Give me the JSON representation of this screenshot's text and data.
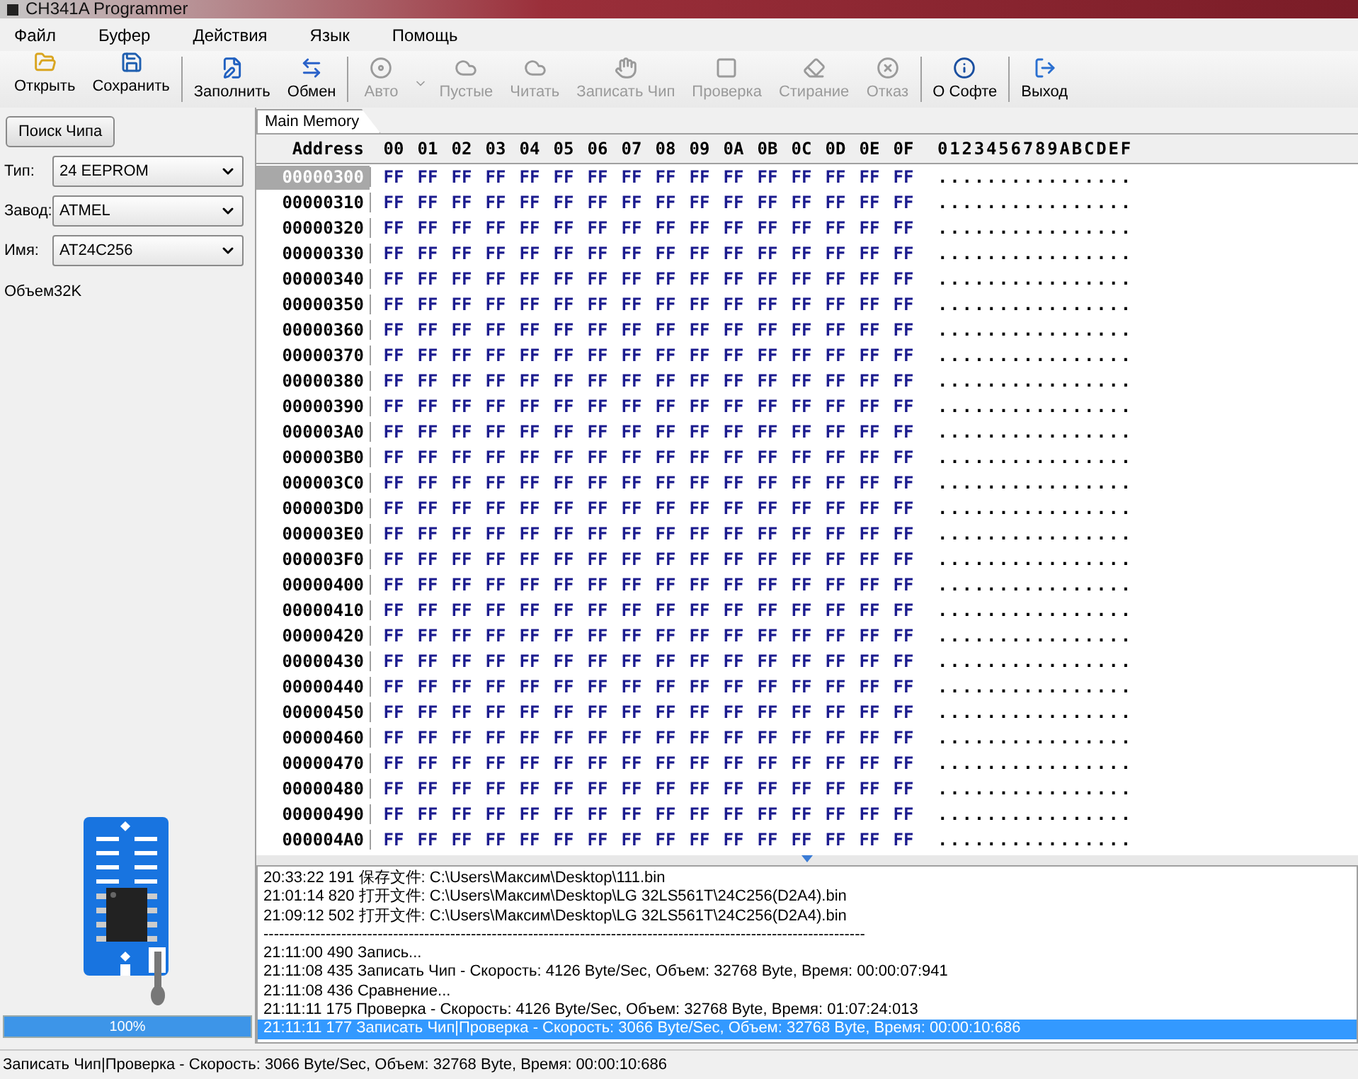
{
  "window": {
    "title": "CH341A Programmer"
  },
  "menu": [
    "Файл",
    "Буфер",
    "Действия",
    "Язык",
    "Помощь"
  ],
  "toolbar": [
    [
      {
        "label": "Открыть",
        "disabled": false
      },
      {
        "label": "Сохранить",
        "disabled": false
      }
    ],
    [
      {
        "label": "Заполнить",
        "disabled": false
      },
      {
        "label": "Обмен",
        "disabled": false
      }
    ],
    [
      {
        "label": "Авто",
        "disabled": true,
        "dropdown": true
      },
      {
        "label": "Пустые",
        "disabled": true
      },
      {
        "label": "Читать",
        "disabled": true
      },
      {
        "label": "Записать Чип",
        "disabled": true
      },
      {
        "label": "Проверка",
        "disabled": true
      },
      {
        "label": "Стирание",
        "disabled": true
      },
      {
        "label": "Отказ",
        "disabled": true
      }
    ],
    [
      {
        "label": "О Софте",
        "disabled": false
      }
    ],
    [
      {
        "label": "Выход",
        "disabled": false
      }
    ]
  ],
  "sidebar": {
    "search_button": "Поиск Чипа",
    "fields": [
      {
        "label": "Тип:",
        "value": "24 EEPROM"
      },
      {
        "label": "Завод:",
        "value": "ATMEL"
      },
      {
        "label": "Имя:",
        "value": "AT24C256"
      }
    ],
    "size": "Объем32K",
    "progress": {
      "level": 1,
      "text": "100%"
    }
  },
  "hex": {
    "tab": "Main Memory",
    "address_header": "Address",
    "columns": [
      "00",
      "01",
      "02",
      "03",
      "04",
      "05",
      "06",
      "07",
      "08",
      "09",
      "0A",
      "0B",
      "0C",
      "0D",
      "0E",
      "0F"
    ],
    "ascii_header": "0123456789ABCDEF",
    "rows": [
      {
        "address": "00000300",
        "selected": true,
        "bytes": [
          "FF",
          "FF",
          "FF",
          "FF",
          "FF",
          "FF",
          "FF",
          "FF",
          "FF",
          "FF",
          "FF",
          "FF",
          "FF",
          "FF",
          "FF",
          "FF"
        ],
        "ascii": "................"
      },
      {
        "address": "00000310",
        "selected": false,
        "bytes": [
          "FF",
          "FF",
          "FF",
          "FF",
          "FF",
          "FF",
          "FF",
          "FF",
          "FF",
          "FF",
          "FF",
          "FF",
          "FF",
          "FF",
          "FF",
          "FF"
        ],
        "ascii": "................"
      },
      {
        "address": "00000320",
        "selected": false,
        "bytes": [
          "FF",
          "FF",
          "FF",
          "FF",
          "FF",
          "FF",
          "FF",
          "FF",
          "FF",
          "FF",
          "FF",
          "FF",
          "FF",
          "FF",
          "FF",
          "FF"
        ],
        "ascii": "................"
      },
      {
        "address": "00000330",
        "selected": false,
        "bytes": [
          "FF",
          "FF",
          "FF",
          "FF",
          "FF",
          "FF",
          "FF",
          "FF",
          "FF",
          "FF",
          "FF",
          "FF",
          "FF",
          "FF",
          "FF",
          "FF"
        ],
        "ascii": "................"
      },
      {
        "address": "00000340",
        "selected": false,
        "bytes": [
          "FF",
          "FF",
          "FF",
          "FF",
          "FF",
          "FF",
          "FF",
          "FF",
          "FF",
          "FF",
          "FF",
          "FF",
          "FF",
          "FF",
          "FF",
          "FF"
        ],
        "ascii": "................"
      },
      {
        "address": "00000350",
        "selected": false,
        "bytes": [
          "FF",
          "FF",
          "FF",
          "FF",
          "FF",
          "FF",
          "FF",
          "FF",
          "FF",
          "FF",
          "FF",
          "FF",
          "FF",
          "FF",
          "FF",
          "FF"
        ],
        "ascii": "................"
      },
      {
        "address": "00000360",
        "selected": false,
        "bytes": [
          "FF",
          "FF",
          "FF",
          "FF",
          "FF",
          "FF",
          "FF",
          "FF",
          "FF",
          "FF",
          "FF",
          "FF",
          "FF",
          "FF",
          "FF",
          "FF"
        ],
        "ascii": "................"
      },
      {
        "address": "00000370",
        "selected": false,
        "bytes": [
          "FF",
          "FF",
          "FF",
          "FF",
          "FF",
          "FF",
          "FF",
          "FF",
          "FF",
          "FF",
          "FF",
          "FF",
          "FF",
          "FF",
          "FF",
          "FF"
        ],
        "ascii": "................"
      },
      {
        "address": "00000380",
        "selected": false,
        "bytes": [
          "FF",
          "FF",
          "FF",
          "FF",
          "FF",
          "FF",
          "FF",
          "FF",
          "FF",
          "FF",
          "FF",
          "FF",
          "FF",
          "FF",
          "FF",
          "FF"
        ],
        "ascii": "................"
      },
      {
        "address": "00000390",
        "selected": false,
        "bytes": [
          "FF",
          "FF",
          "FF",
          "FF",
          "FF",
          "FF",
          "FF",
          "FF",
          "FF",
          "FF",
          "FF",
          "FF",
          "FF",
          "FF",
          "FF",
          "FF"
        ],
        "ascii": "................"
      },
      {
        "address": "000003A0",
        "selected": false,
        "bytes": [
          "FF",
          "FF",
          "FF",
          "FF",
          "FF",
          "FF",
          "FF",
          "FF",
          "FF",
          "FF",
          "FF",
          "FF",
          "FF",
          "FF",
          "FF",
          "FF"
        ],
        "ascii": "................"
      },
      {
        "address": "000003B0",
        "selected": false,
        "bytes": [
          "FF",
          "FF",
          "FF",
          "FF",
          "FF",
          "FF",
          "FF",
          "FF",
          "FF",
          "FF",
          "FF",
          "FF",
          "FF",
          "FF",
          "FF",
          "FF"
        ],
        "ascii": "................"
      },
      {
        "address": "000003C0",
        "selected": false,
        "bytes": [
          "FF",
          "FF",
          "FF",
          "FF",
          "FF",
          "FF",
          "FF",
          "FF",
          "FF",
          "FF",
          "FF",
          "FF",
          "FF",
          "FF",
          "FF",
          "FF"
        ],
        "ascii": "................"
      },
      {
        "address": "000003D0",
        "selected": false,
        "bytes": [
          "FF",
          "FF",
          "FF",
          "FF",
          "FF",
          "FF",
          "FF",
          "FF",
          "FF",
          "FF",
          "FF",
          "FF",
          "FF",
          "FF",
          "FF",
          "FF"
        ],
        "ascii": "................"
      },
      {
        "address": "000003E0",
        "selected": false,
        "bytes": [
          "FF",
          "FF",
          "FF",
          "FF",
          "FF",
          "FF",
          "FF",
          "FF",
          "FF",
          "FF",
          "FF",
          "FF",
          "FF",
          "FF",
          "FF",
          "FF"
        ],
        "ascii": "................"
      },
      {
        "address": "000003F0",
        "selected": false,
        "bytes": [
          "FF",
          "FF",
          "FF",
          "FF",
          "FF",
          "FF",
          "FF",
          "FF",
          "FF",
          "FF",
          "FF",
          "FF",
          "FF",
          "FF",
          "FF",
          "FF"
        ],
        "ascii": "................"
      },
      {
        "address": "00000400",
        "selected": false,
        "bytes": [
          "FF",
          "FF",
          "FF",
          "FF",
          "FF",
          "FF",
          "FF",
          "FF",
          "FF",
          "FF",
          "FF",
          "FF",
          "FF",
          "FF",
          "FF",
          "FF"
        ],
        "ascii": "................"
      },
      {
        "address": "00000410",
        "selected": false,
        "bytes": [
          "FF",
          "FF",
          "FF",
          "FF",
          "FF",
          "FF",
          "FF",
          "FF",
          "FF",
          "FF",
          "FF",
          "FF",
          "FF",
          "FF",
          "FF",
          "FF"
        ],
        "ascii": "................"
      },
      {
        "address": "00000420",
        "selected": false,
        "bytes": [
          "FF",
          "FF",
          "FF",
          "FF",
          "FF",
          "FF",
          "FF",
          "FF",
          "FF",
          "FF",
          "FF",
          "FF",
          "FF",
          "FF",
          "FF",
          "FF"
        ],
        "ascii": "................"
      },
      {
        "address": "00000430",
        "selected": false,
        "bytes": [
          "FF",
          "FF",
          "FF",
          "FF",
          "FF",
          "FF",
          "FF",
          "FF",
          "FF",
          "FF",
          "FF",
          "FF",
          "FF",
          "FF",
          "FF",
          "FF"
        ],
        "ascii": "................"
      },
      {
        "address": "00000440",
        "selected": false,
        "bytes": [
          "FF",
          "FF",
          "FF",
          "FF",
          "FF",
          "FF",
          "FF",
          "FF",
          "FF",
          "FF",
          "FF",
          "FF",
          "FF",
          "FF",
          "FF",
          "FF"
        ],
        "ascii": "................"
      },
      {
        "address": "00000450",
        "selected": false,
        "bytes": [
          "FF",
          "FF",
          "FF",
          "FF",
          "FF",
          "FF",
          "FF",
          "FF",
          "FF",
          "FF",
          "FF",
          "FF",
          "FF",
          "FF",
          "FF",
          "FF"
        ],
        "ascii": "................"
      },
      {
        "address": "00000460",
        "selected": false,
        "bytes": [
          "FF",
          "FF",
          "FF",
          "FF",
          "FF",
          "FF",
          "FF",
          "FF",
          "FF",
          "FF",
          "FF",
          "FF",
          "FF",
          "FF",
          "FF",
          "FF"
        ],
        "ascii": "................"
      },
      {
        "address": "00000470",
        "selected": false,
        "bytes": [
          "FF",
          "FF",
          "FF",
          "FF",
          "FF",
          "FF",
          "FF",
          "FF",
          "FF",
          "FF",
          "FF",
          "FF",
          "FF",
          "FF",
          "FF",
          "FF"
        ],
        "ascii": "................"
      },
      {
        "address": "00000480",
        "selected": false,
        "bytes": [
          "FF",
          "FF",
          "FF",
          "FF",
          "FF",
          "FF",
          "FF",
          "FF",
          "FF",
          "FF",
          "FF",
          "FF",
          "FF",
          "FF",
          "FF",
          "FF"
        ],
        "ascii": "................"
      },
      {
        "address": "00000490",
        "selected": false,
        "bytes": [
          "FF",
          "FF",
          "FF",
          "FF",
          "FF",
          "FF",
          "FF",
          "FF",
          "FF",
          "FF",
          "FF",
          "FF",
          "FF",
          "FF",
          "FF",
          "FF"
        ],
        "ascii": "................"
      },
      {
        "address": "000004A0",
        "selected": false,
        "bytes": [
          "FF",
          "FF",
          "FF",
          "FF",
          "FF",
          "FF",
          "FF",
          "FF",
          "FF",
          "FF",
          "FF",
          "FF",
          "FF",
          "FF",
          "FF",
          "FF"
        ],
        "ascii": "................"
      }
    ]
  },
  "log": [
    {
      "text": "20:33:22 191 保存文件: C:\\Users\\Максим\\Desktop\\111.bin",
      "selected": false
    },
    {
      "text": "21:01:14 820 打开文件: C:\\Users\\Максим\\Desktop\\LG 32LS561T\\24C256(D2A4).bin",
      "selected": false
    },
    {
      "text": "21:09:12 502 打开文件: C:\\Users\\Максим\\Desktop\\LG 32LS561T\\24C256(D2A4).bin",
      "selected": false
    },
    {
      "text": "--------------------------------------------------------------------------------------------------------------------",
      "selected": false
    },
    {
      "text": "21:11:00 490 Запись...",
      "selected": false
    },
    {
      "text": "21:11:08 435 Записать Чип - Скорость: 4126 Byte/Sec, Объем: 32768 Byte, Время: 00:00:07:941",
      "selected": false
    },
    {
      "text": "21:11:08 436 Сравнение...",
      "selected": false
    },
    {
      "text": "21:11:11 175 Проверка - Скорость: 4126 Byte/Sec, Объем: 32768 Byte, Время: 01:07:24:013",
      "selected": false
    },
    {
      "text": "21:11:11 177 Записать Чип|Проверка - Скорость: 3066 Byte/Sec, Объем: 32768 Byte, Время: 00:00:10:686",
      "selected": true
    }
  ],
  "status_bar": "Записать Чип|Проверка - Скорость: 3066 Byte/Sec, Объем: 32768 Byte, Время: 00:00:10:686"
}
